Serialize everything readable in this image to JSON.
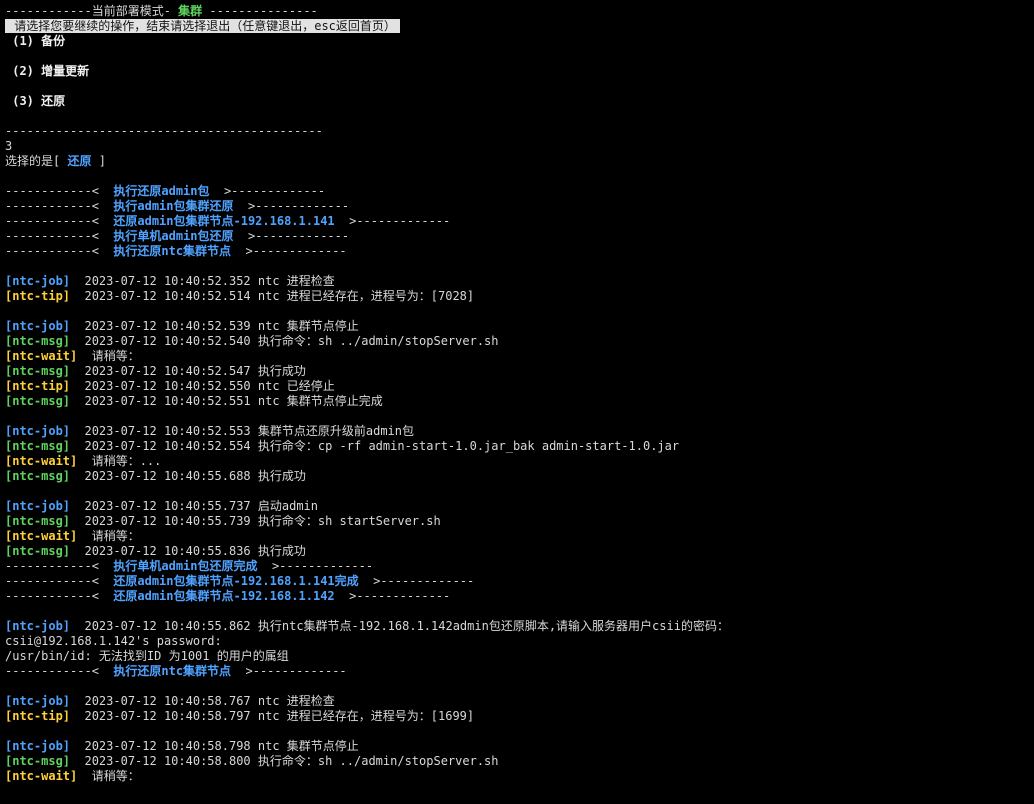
{
  "colors": {
    "background": "#000000",
    "text": "#d8d8d8",
    "mode_green": "#5fd35f",
    "highlight_bg": "#e2e2e2",
    "tag_job": "#4fa3ff",
    "tag_msg": "#5fd35f",
    "tag_tip_wait": "#ffd23a"
  },
  "terminal": {
    "lines": [
      {
        "type": "header",
        "prefix": "------------当前部署模式- ",
        "mode": "集群",
        "suffix": " ---------------"
      },
      {
        "type": "highlight",
        "text": " 请选择您要继续的操作，结束请选择退出（任意键退出，esc返回首页）"
      },
      {
        "type": "bold",
        "text": " (1) 备份"
      },
      {
        "type": "blank"
      },
      {
        "type": "bold",
        "text": " (2) 增量更新"
      },
      {
        "type": "blank"
      },
      {
        "type": "bold",
        "text": " (3) 还原"
      },
      {
        "type": "blank"
      },
      {
        "type": "plain",
        "text": "--------------------------------------------"
      },
      {
        "type": "plain",
        "text": "3"
      },
      {
        "type": "choice",
        "prefix": "选择的是[ ",
        "value": "还原",
        "suffix": " ]"
      },
      {
        "type": "blank"
      },
      {
        "type": "section",
        "left": "------------<  ",
        "label": "执行还原admin包",
        "right": "  >-------------"
      },
      {
        "type": "section",
        "left": "------------<  ",
        "label": "执行admin包集群还原",
        "right": "  >-------------"
      },
      {
        "type": "section",
        "left": "------------<  ",
        "label": "还原admin包集群节点-192.168.1.141",
        "right": "  >-------------"
      },
      {
        "type": "section",
        "left": "------------<  ",
        "label": "执行单机admin包还原",
        "right": "  >-------------"
      },
      {
        "type": "section",
        "left": "------------<  ",
        "label": "执行还原ntc集群节点",
        "right": "  >-------------"
      },
      {
        "type": "blank"
      },
      {
        "type": "log",
        "tag": "[ntc-job]",
        "kind": "job",
        "gap": "  ",
        "text": "2023-07-12 10:40:52.352 ntc 进程检查"
      },
      {
        "type": "log",
        "tag": "[ntc-tip]",
        "kind": "tip",
        "gap": "  ",
        "text": "2023-07-12 10:40:52.514 ntc 进程已经存在，进程号为：[7028]"
      },
      {
        "type": "blank"
      },
      {
        "type": "log",
        "tag": "[ntc-job]",
        "kind": "job",
        "gap": "  ",
        "text": "2023-07-12 10:40:52.539 ntc 集群节点停止"
      },
      {
        "type": "log",
        "tag": "[ntc-msg]",
        "kind": "msg",
        "gap": "  ",
        "text": "2023-07-12 10:40:52.540 执行命令：sh ../admin/stopServer.sh"
      },
      {
        "type": "log",
        "tag": "[ntc-wait]",
        "kind": "wait",
        "gap": "  ",
        "text": "请稍等："
      },
      {
        "type": "log",
        "tag": "[ntc-msg]",
        "kind": "msg",
        "gap": "  ",
        "text": "2023-07-12 10:40:52.547 执行成功"
      },
      {
        "type": "log",
        "tag": "[ntc-tip]",
        "kind": "tip",
        "gap": "  ",
        "text": "2023-07-12 10:40:52.550 ntc 已经停止"
      },
      {
        "type": "log",
        "tag": "[ntc-msg]",
        "kind": "msg",
        "gap": "  ",
        "text": "2023-07-12 10:40:52.551 ntc 集群节点停止完成"
      },
      {
        "type": "blank"
      },
      {
        "type": "log",
        "tag": "[ntc-job]",
        "kind": "job",
        "gap": "  ",
        "text": "2023-07-12 10:40:52.553 集群节点还原升级前admin包"
      },
      {
        "type": "log",
        "tag": "[ntc-msg]",
        "kind": "msg",
        "gap": "  ",
        "text": "2023-07-12 10:40:52.554 执行命令：cp -rf admin-start-1.0.jar_bak admin-start-1.0.jar"
      },
      {
        "type": "log",
        "tag": "[ntc-wait]",
        "kind": "wait",
        "gap": "  ",
        "text": "请稍等：..."
      },
      {
        "type": "log",
        "tag": "[ntc-msg]",
        "kind": "msg",
        "gap": "  ",
        "text": "2023-07-12 10:40:55.688 执行成功"
      },
      {
        "type": "blank"
      },
      {
        "type": "log",
        "tag": "[ntc-job]",
        "kind": "job",
        "gap": "  ",
        "text": "2023-07-12 10:40:55.737 启动admin"
      },
      {
        "type": "log",
        "tag": "[ntc-msg]",
        "kind": "msg",
        "gap": "  ",
        "text": "2023-07-12 10:40:55.739 执行命令：sh startServer.sh"
      },
      {
        "type": "log",
        "tag": "[ntc-wait]",
        "kind": "wait",
        "gap": "  ",
        "text": "请稍等："
      },
      {
        "type": "log",
        "tag": "[ntc-msg]",
        "kind": "msg",
        "gap": "  ",
        "text": "2023-07-12 10:40:55.836 执行成功"
      },
      {
        "type": "section",
        "left": "------------<  ",
        "label": "执行单机admin包还原完成",
        "right": "  >-------------"
      },
      {
        "type": "section",
        "left": "------------<  ",
        "label": "还原admin包集群节点-192.168.1.141完成",
        "right": "  >-------------"
      },
      {
        "type": "section",
        "left": "------------<  ",
        "label": "还原admin包集群节点-192.168.1.142",
        "right": "  >-------------"
      },
      {
        "type": "blank"
      },
      {
        "type": "log",
        "tag": "[ntc-job]",
        "kind": "job",
        "gap": "  ",
        "text": "2023-07-12 10:40:55.862 执行ntc集群节点-192.168.1.142admin包还原脚本,请输入服务器用户csii的密码："
      },
      {
        "type": "plain",
        "text": "csii@192.168.1.142's password:"
      },
      {
        "type": "plain",
        "text": "/usr/bin/id: 无法找到ID 为1001 的用户的属组"
      },
      {
        "type": "section",
        "left": "------------<  ",
        "label": "执行还原ntc集群节点",
        "right": "  >-------------"
      },
      {
        "type": "blank"
      },
      {
        "type": "log",
        "tag": "[ntc-job]",
        "kind": "job",
        "gap": "  ",
        "text": "2023-07-12 10:40:58.767 ntc 进程检查"
      },
      {
        "type": "log",
        "tag": "[ntc-tip]",
        "kind": "tip",
        "gap": "  ",
        "text": "2023-07-12 10:40:58.797 ntc 进程已经存在，进程号为：[1699]"
      },
      {
        "type": "blank"
      },
      {
        "type": "log",
        "tag": "[ntc-job]",
        "kind": "job",
        "gap": "  ",
        "text": "2023-07-12 10:40:58.798 ntc 集群节点停止"
      },
      {
        "type": "log",
        "tag": "[ntc-msg]",
        "kind": "msg",
        "gap": "  ",
        "text": "2023-07-12 10:40:58.800 执行命令：sh ../admin/stopServer.sh"
      },
      {
        "type": "log",
        "tag": "[ntc-wait]",
        "kind": "wait",
        "gap": "  ",
        "text": "请稍等："
      }
    ]
  }
}
